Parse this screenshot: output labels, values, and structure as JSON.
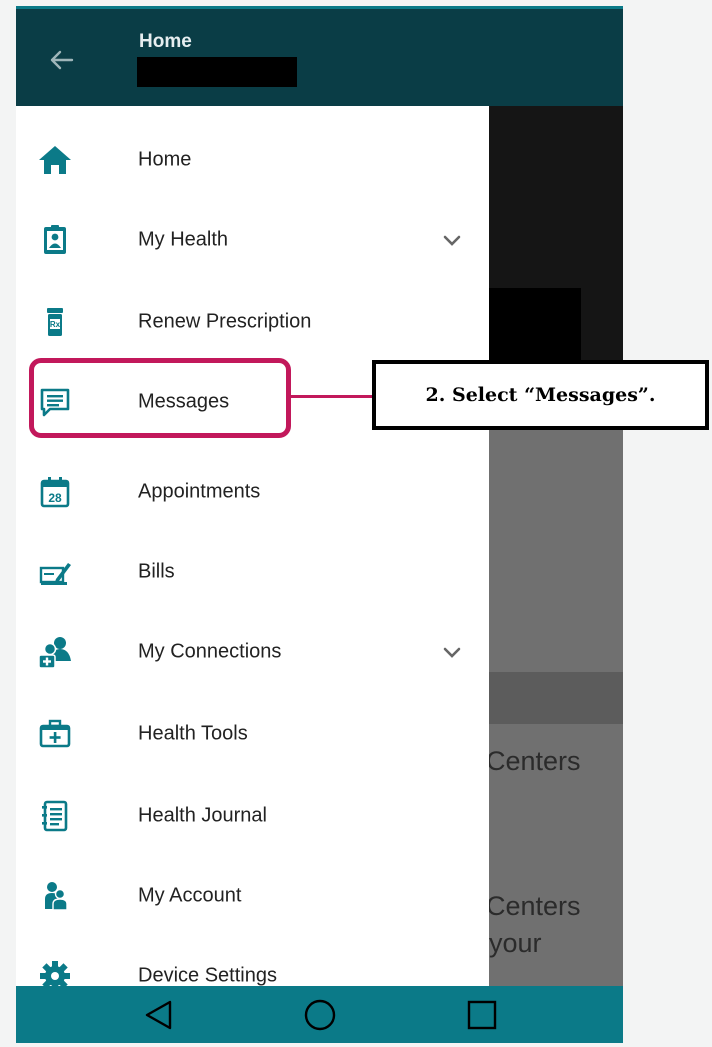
{
  "appbar": {
    "title": "Home"
  },
  "backdrop": {
    "text_1": "Centers",
    "text_2": "Centers",
    "text_3": "your"
  },
  "menu": {
    "items": [
      {
        "label": "Home",
        "icon": "home-icon"
      },
      {
        "label": "My Health",
        "icon": "patient-card-icon",
        "expandable": true
      },
      {
        "label": "Renew Prescription",
        "icon": "prescription-bottle-icon"
      },
      {
        "label": "Messages",
        "icon": "message-icon"
      },
      {
        "label": "Appointments",
        "icon": "calendar-icon",
        "icon_text": "28"
      },
      {
        "label": "Bills",
        "icon": "bill-icon"
      },
      {
        "label": "My Connections",
        "icon": "connections-icon",
        "expandable": true
      },
      {
        "label": "Health Tools",
        "icon": "medical-kit-icon"
      },
      {
        "label": "Health Journal",
        "icon": "journal-icon"
      },
      {
        "label": "My Account",
        "icon": "account-icon"
      },
      {
        "label": "Device Settings",
        "icon": "gear-icon"
      }
    ]
  },
  "callout": {
    "text": "2.  Select “Messages”."
  },
  "colors": {
    "teal": "#0b7a88",
    "appbar": "#0a3d46",
    "highlight": "#c2185b"
  }
}
